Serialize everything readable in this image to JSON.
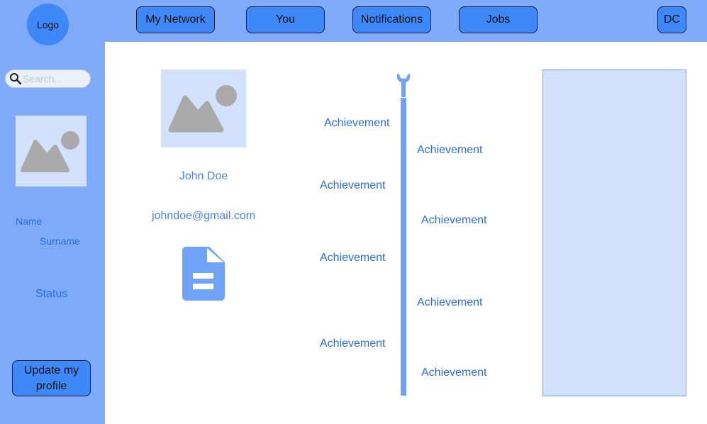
{
  "header": {
    "logo_label": "Logo",
    "nav": [
      {
        "label": "My Network"
      },
      {
        "label": "You"
      },
      {
        "label": "Notifications"
      },
      {
        "label": "Jobs"
      }
    ],
    "user_initials": "DC"
  },
  "sidebar": {
    "search_placeholder": "Search...",
    "name_label": "Name",
    "surname_label": "Surname",
    "status_label": "Status",
    "update_button": "Update my profile"
  },
  "profile": {
    "name": "John Doe",
    "email": "johndoe@gmail.com"
  },
  "timeline": {
    "achievements": [
      {
        "label": "Achievement",
        "side": "left"
      },
      {
        "label": "Achievement",
        "side": "right"
      },
      {
        "label": "Achievement",
        "side": "left"
      },
      {
        "label": "Achievement",
        "side": "right"
      },
      {
        "label": "Achievement",
        "side": "left"
      },
      {
        "label": "Achievement",
        "side": "right"
      },
      {
        "label": "Achievement",
        "side": "left"
      },
      {
        "label": "Achievement",
        "side": "right"
      }
    ]
  },
  "icons": {
    "search": "search-icon",
    "image": "image-placeholder-icon",
    "document": "document-icon",
    "wrench": "wrench-icon"
  },
  "colors": {
    "sidebar_bg": "#7eaaf8",
    "button_bg": "#3f88f7",
    "placeholder_bg": "#d3e2fc",
    "text_accent": "#2b6de0"
  }
}
